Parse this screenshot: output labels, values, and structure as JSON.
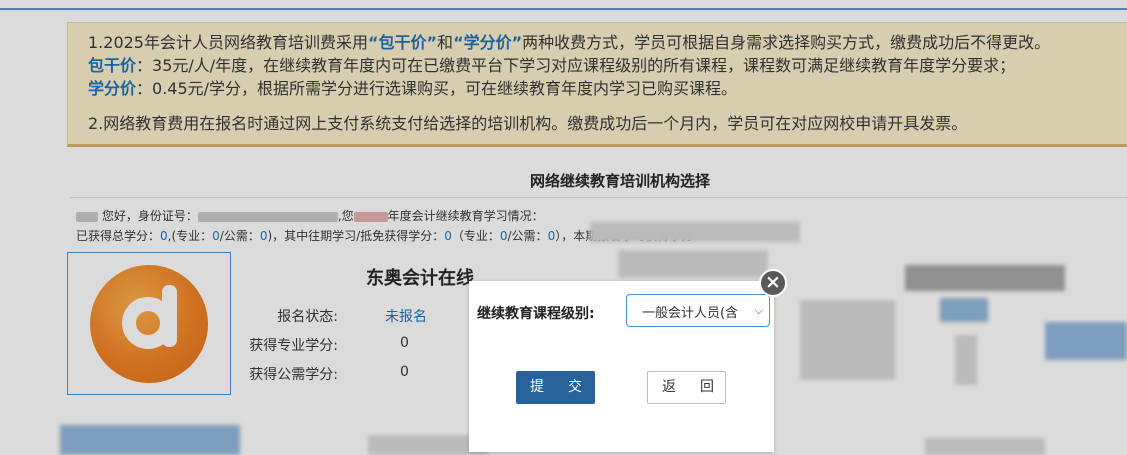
{
  "notice": {
    "line1": "1.2025年会计人员网络教育培训费采用",
    "hl1": "“包干价”",
    "line1_mid": "和",
    "hl2": "“学分价”",
    "line1_end": "两种收费方式，学员可根据自身需求选择购买方式，缴费成功后不得更改。",
    "label2": "包干价",
    "line2": "：35元/人/年度，在继续教育年度内可在已缴费平台下学习对应课程级别的所有课程，课程数可满足继续教育年度学分要求；",
    "label3": "学分价",
    "line3": "：0.45元/学分，根据所需学分进行选课购买，可在继续教育年度内学习已购买课程。",
    "line4": "2.网络教育费用在报名时通过网上支付系统支付给选择的培训机构。缴费成功后一个月内，学员可在对应网校申请开具发票。"
  },
  "section_title": "网络继续教育培训机构选择",
  "info": {
    "greet": "您好，身份证号：",
    "greet_end": "年度会计继续教育学习情况：",
    "credits_prefix": "已获得总学分：",
    "total": "0",
    "major_label": ",(专业：",
    "major": "0",
    "public_label": "/公需：",
    "public": "0",
    "mid": ")，其中往期学习/抵免获得学分：",
    "prev": "0",
    "major_label2": "（专业：",
    "major2": "0",
    "public_label2": "/公需：",
    "public2": "0",
    "end": "），本期报名学习获得学分"
  },
  "org": {
    "name": "东奥会计在线",
    "status_label": "报名状态:",
    "status_value": "未报名",
    "major_label": "获得专业学分:",
    "major_value": "0",
    "public_label": "获得公需学分:",
    "public_value": "0"
  },
  "modal": {
    "label": "继续教育课程级别:",
    "selected": "一般会计人员(含",
    "submit": "提交",
    "back": "返回"
  },
  "colors": {
    "accent": "#27639a",
    "link": "#1a6eb8",
    "notice_bg": "#fbefcb"
  }
}
